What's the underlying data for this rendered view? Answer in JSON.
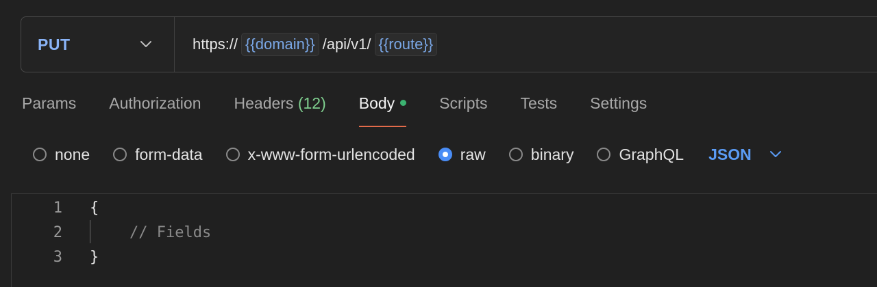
{
  "request": {
    "method": "PUT",
    "url_parts": [
      {
        "type": "text",
        "value": "https://"
      },
      {
        "type": "var",
        "value": "{{domain}}"
      },
      {
        "type": "text",
        "value": "/api/v1/"
      },
      {
        "type": "var",
        "value": "{{route}}"
      }
    ]
  },
  "tabs": [
    {
      "label": "Params"
    },
    {
      "label": "Authorization"
    },
    {
      "label": "Headers",
      "count": "(12)"
    },
    {
      "label": "Body",
      "active": true,
      "indicator": true
    },
    {
      "label": "Scripts"
    },
    {
      "label": "Tests"
    },
    {
      "label": "Settings"
    }
  ],
  "body_types": [
    {
      "label": "none",
      "checked": false
    },
    {
      "label": "form-data",
      "checked": false
    },
    {
      "label": "x-www-form-urlencoded",
      "checked": false
    },
    {
      "label": "raw",
      "checked": true
    },
    {
      "label": "binary",
      "checked": false
    },
    {
      "label": "GraphQL",
      "checked": false
    }
  ],
  "format": "JSON",
  "editor": {
    "lines": [
      {
        "number": "1",
        "text": "{"
      },
      {
        "number": "2",
        "text": "// Fields",
        "comment": true
      },
      {
        "number": "3",
        "text": "}"
      }
    ]
  },
  "colors": {
    "accent": "#5b9cf5",
    "tab_underline": "#e36b4a",
    "body_dot": "#3cb371",
    "count": "#7fcf8f"
  }
}
